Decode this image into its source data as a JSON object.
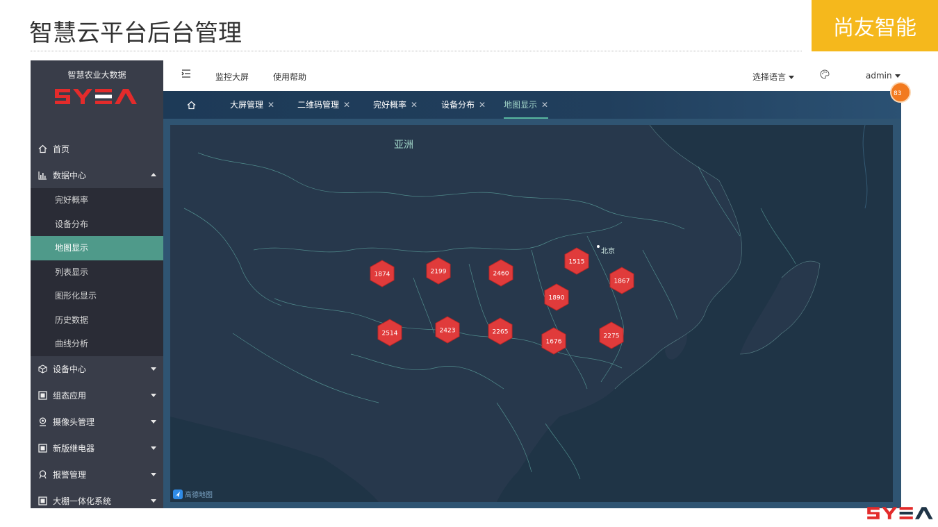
{
  "slide": {
    "title": "智慧云平台后台管理",
    "brand_badge": "尚友智能"
  },
  "sidebar": {
    "app_name": "智慧农业大数据",
    "logo_text": "SYEA",
    "menu": [
      {
        "label": "首页",
        "icon": "home-icon"
      },
      {
        "label": "数据中心",
        "icon": "chart-icon",
        "expanded": true
      },
      {
        "label": "设备中心",
        "icon": "cube-icon"
      },
      {
        "label": "组态应用",
        "icon": "grid-icon"
      },
      {
        "label": "摄像头管理",
        "icon": "camera-icon"
      },
      {
        "label": "新版继电器",
        "icon": "grid-icon"
      },
      {
        "label": "报警管理",
        "icon": "alarm-icon"
      },
      {
        "label": "大棚一体化系统",
        "icon": "grid-icon"
      }
    ],
    "submenu": [
      "完好概率",
      "设备分布",
      "地图显示",
      "列表显示",
      "图形化显示",
      "历史数据",
      "曲线分析"
    ],
    "active_submenu": "地图显示"
  },
  "topbar": {
    "menu_toggle_icon": "menu-toggle-icon",
    "links": [
      "监控大屏",
      "使用帮助"
    ],
    "language": "选择语言",
    "theme_icon": "palette-icon",
    "user": "admin"
  },
  "tabs": [
    {
      "label": "大屏管理",
      "closable": true
    },
    {
      "label": "二维码管理",
      "closable": true
    },
    {
      "label": "完好概率",
      "closable": true
    },
    {
      "label": "设备分布",
      "closable": true
    },
    {
      "label": "地图显示",
      "closable": true,
      "active": true
    }
  ],
  "map": {
    "region_label": "亚洲",
    "city_label": "北京",
    "clusters": [
      1874,
      2199,
      2460,
      1515,
      1867,
      1890,
      2514,
      2423,
      2265,
      1676,
      2275
    ],
    "watermark": "高德地图"
  },
  "notification_count": "83",
  "colors": {
    "sidebar_bg": "#393d49",
    "active_item": "#4f9a8a",
    "badge_yellow": "#f5b81c",
    "cluster_red": "#e03b3b",
    "map_bg": "#1f3446"
  }
}
